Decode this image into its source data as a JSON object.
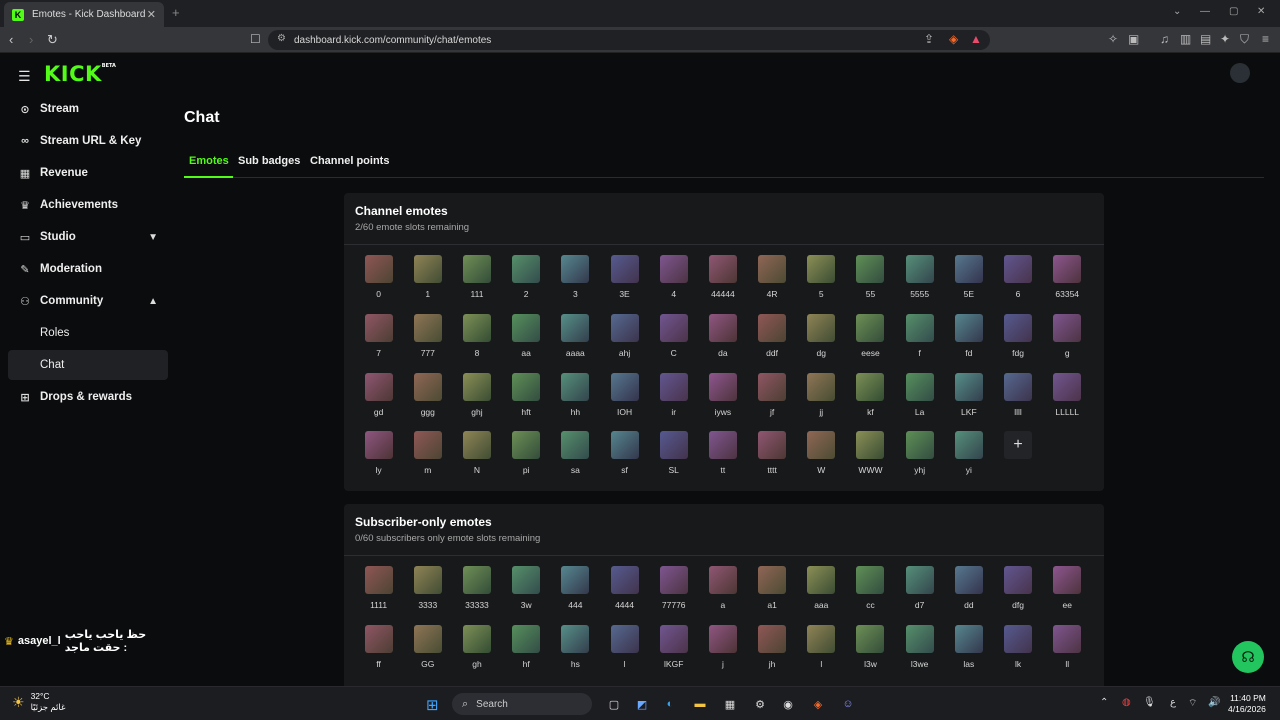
{
  "browser": {
    "tab_title": "Emotes - Kick Dashboard",
    "favicon_letter": "K",
    "url": "dashboard.kick.com/community/chat/emotes"
  },
  "sidebar": {
    "logo": "KICK",
    "logo_badge": "BETA",
    "items": [
      {
        "label": "Stream",
        "icon": "broadcast-icon"
      },
      {
        "label": "Stream URL & Key",
        "icon": "link-icon"
      },
      {
        "label": "Revenue",
        "icon": "chart-icon"
      },
      {
        "label": "Achievements",
        "icon": "trophy-icon"
      },
      {
        "label": "Studio",
        "icon": "studio-icon"
      },
      {
        "label": "Moderation",
        "icon": "wrench-icon"
      },
      {
        "label": "Community",
        "icon": "community-icon"
      },
      {
        "label": "Roles"
      },
      {
        "label": "Chat"
      },
      {
        "label": "Drops & rewards",
        "icon": "gift-icon"
      }
    ]
  },
  "chat_overlay": {
    "username": "asayel_l",
    "message": "حظ ياحب ياحب حقت ماجد :"
  },
  "main": {
    "title": "Chat",
    "tabs": [
      "Emotes",
      "Sub badges",
      "Channel points"
    ]
  },
  "channel_emotes": {
    "title": "Channel emotes",
    "subtitle": "2/60 emote slots remaining",
    "items": [
      "0",
      "1",
      "111",
      "2",
      "3",
      "3E",
      "4",
      "44444",
      "4R",
      "5",
      "55",
      "5555",
      "5E",
      "6",
      "63354",
      "7",
      "777",
      "8",
      "aa",
      "aaaa",
      "ahj",
      "C",
      "da",
      "ddf",
      "dg",
      "eese",
      "f",
      "fd",
      "fdg",
      "g",
      "gd",
      "ggg",
      "ghj",
      "hft",
      "hh",
      "IOH",
      "ir",
      "iyws",
      "jf",
      "jj",
      "kf",
      "La",
      "LKF",
      "llll",
      "LLLLL",
      "ly",
      "m",
      "N",
      "pi",
      "sa",
      "sf",
      "SL",
      "tt",
      "tttt",
      "W",
      "WWW",
      "yhj",
      "yi"
    ],
    "add_label": "+"
  },
  "subscriber_emotes": {
    "title": "Subscriber-only emotes",
    "subtitle": "0/60 subscribers only emote slots remaining",
    "items": [
      "1111",
      "3333",
      "33333",
      "3w",
      "444",
      "4444",
      "77776",
      "a",
      "a1",
      "aaa",
      "cc",
      "d7",
      "dd",
      "dfg",
      "ee",
      "ff",
      "GG",
      "gh",
      "hf",
      "hs",
      "l",
      "lKGF",
      "j",
      "jh",
      "l",
      "l3w",
      "l3we",
      "las",
      "lk",
      "ll"
    ]
  },
  "taskbar": {
    "temperature": "32°C",
    "weather_text": "غائم جزئيًا",
    "search_label": "Search",
    "language": "ع",
    "time": "11:40 PM",
    "date": "4/16/2026"
  },
  "colors": {
    "accent": "#53fc18",
    "card": "#18191b",
    "background": "#0b0c0d"
  }
}
